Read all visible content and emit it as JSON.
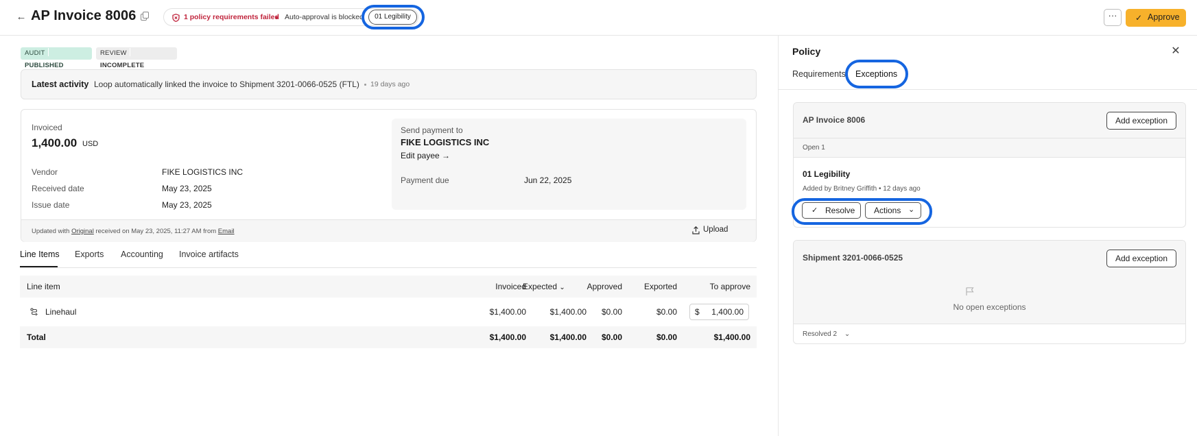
{
  "header": {
    "title": "AP Invoice 8006",
    "policy_failed": "1 policy requirements failed",
    "auto_approval": "Auto-approval is blocked",
    "legibility_chip": "01 Legibility",
    "more": "···",
    "approve": "Approve"
  },
  "tags": {
    "audit_label": "AUDIT",
    "audit_value": "PUBLISHED",
    "review_label": "REVIEW",
    "review_value": "INCOMPLETE"
  },
  "activity": {
    "label": "Latest activity",
    "text": "Loop automatically linked the invoice to Shipment 3201-0066-0525 (FTL)",
    "time": "19 days ago"
  },
  "summary": {
    "invoiced_label": "Invoiced",
    "invoiced_amount": "1,400.00",
    "invoiced_currency": "USD",
    "vendor_label": "Vendor",
    "vendor_value": "FIKE LOGISTICS INC",
    "received_label": "Received date",
    "received_value": "May 23, 2025",
    "issue_label": "Issue date",
    "issue_value": "May 23, 2025",
    "send_payment_label": "Send payment to",
    "payee_name": "FIKE LOGISTICS INC",
    "edit_payee": "Edit payee →",
    "payment_due_label": "Payment due",
    "payment_due_value": "Jun 22, 2025",
    "footer_prefix": "Updated with",
    "footer_original": "Original",
    "footer_middle": "received on May 23, 2025, 11:27 AM from",
    "footer_email": "Email",
    "upload": "Upload"
  },
  "tabs": [
    "Line Items",
    "Exports",
    "Accounting",
    "Invoice artifacts"
  ],
  "table": {
    "headers": {
      "line_item": "Line item",
      "invoiced": "Invoiced",
      "expected": "Expected",
      "approved": "Approved",
      "exported": "Exported",
      "to_approve": "To approve"
    },
    "rows": [
      {
        "name": "Linehaul",
        "invoiced": "$1,400.00",
        "expected": "$1,400.00",
        "approved": "$0.00",
        "exported": "$0.00",
        "to_approve_currency": "$",
        "to_approve": "1,400.00"
      }
    ],
    "total": {
      "label": "Total",
      "invoiced": "$1,400.00",
      "expected": "$1,400.00",
      "approved": "$0.00",
      "exported": "$0.00",
      "to_approve": "$1,400.00"
    }
  },
  "panel": {
    "title": "Policy",
    "tab_requirements": "Requirements",
    "tab_exceptions": "Exceptions",
    "card1": {
      "title": "AP Invoice 8006",
      "add_exception": "Add exception",
      "open_label": "Open 1",
      "exception_name": "01 Legibility",
      "exception_meta": "Added by Britney Griffith • 12 days ago",
      "resolve": "Resolve",
      "actions": "Actions"
    },
    "card2": {
      "title": "Shipment 3201-0066-0525",
      "add_exception": "Add exception",
      "empty_text": "No open exceptions",
      "resolved_label": "Resolved 2"
    }
  },
  "colors": {
    "accent_highlight": "#1565e0",
    "approve_button": "#f7b12b",
    "policy_fail": "#c0243c",
    "audit_tag": "#cdeee2"
  }
}
